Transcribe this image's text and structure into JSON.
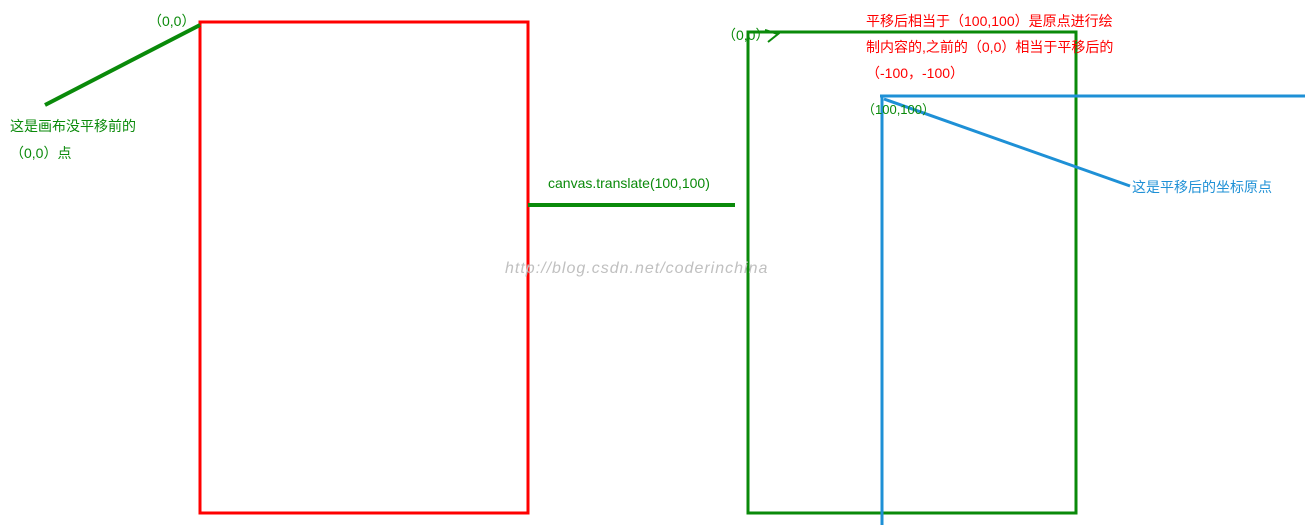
{
  "labels": {
    "origin_left": "（0,0）",
    "origin_right": "（0,0）",
    "shifted_point": "（100,100）",
    "before_translate_line1": "这是画布没平移前的",
    "before_translate_line2": "（0,0）点",
    "translate_code": "canvas.translate(100,100)",
    "red_note_line1": "平移后相当于（100,100）是原点进行绘",
    "red_note_line2": "制内容的,之前的（0,0）相当于平移后的",
    "red_note_line3": "（-100，-100）",
    "after_translate_label": "这是平移后的坐标原点",
    "watermark": "http://blog.csdn.net/coderinchina"
  },
  "colors": {
    "red": "#ff0000",
    "green": "#0a8a0a",
    "blue": "#1e90d6",
    "gray": "#c0c0c0"
  }
}
